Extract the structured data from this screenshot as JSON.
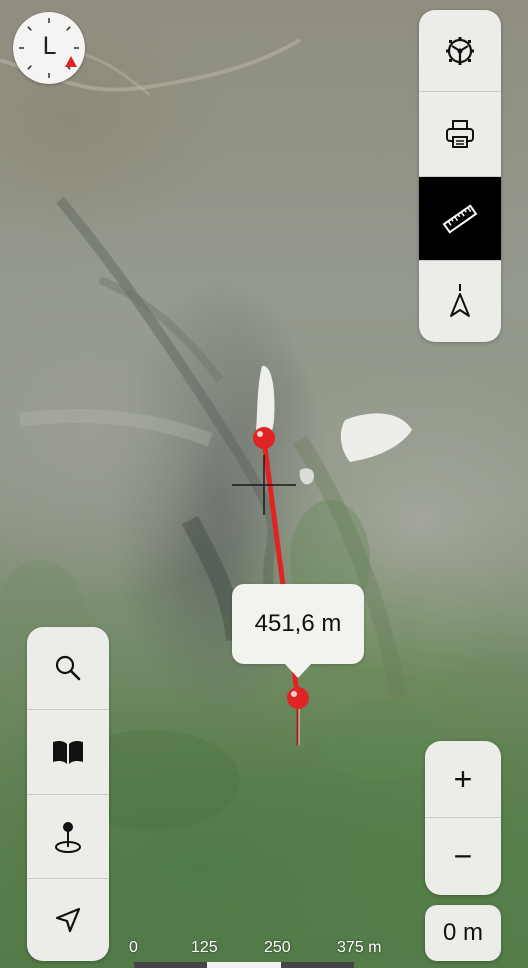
{
  "compass": {
    "letter": "L"
  },
  "right_toolbar": [
    {
      "name": "settings-button",
      "icon": "gear-steering-icon",
      "active": false
    },
    {
      "name": "print-button",
      "icon": "printer-icon",
      "active": false
    },
    {
      "name": "measure-button",
      "icon": "ruler-icon",
      "active": true
    },
    {
      "name": "north-button",
      "icon": "north-arrow-icon",
      "active": false
    }
  ],
  "left_toolbar": [
    {
      "name": "search-button",
      "icon": "magnifier-icon"
    },
    {
      "name": "bookmarks-button",
      "icon": "open-book-icon"
    },
    {
      "name": "place-marker-button",
      "icon": "pin-on-ground-icon"
    },
    {
      "name": "locate-button",
      "icon": "location-arrow-icon"
    }
  ],
  "measurement": {
    "distance_label": "451,6 m",
    "line_color": "#e02424"
  },
  "zoom": {
    "zoom_in_label": "+",
    "zoom_out_label": "−"
  },
  "elevation": {
    "value_label": "0 m"
  },
  "scale_bar": {
    "ticks": [
      "0",
      "125",
      "250",
      "375 m"
    ]
  }
}
